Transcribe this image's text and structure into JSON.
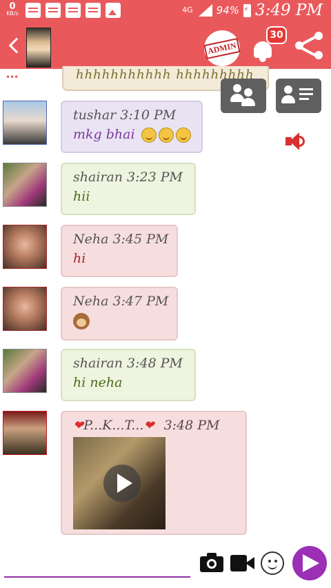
{
  "statusbar": {
    "data_speed": "0",
    "data_unit": "KB/s",
    "network": "4G",
    "battery": "94%",
    "time": "3:49 PM"
  },
  "appbar": {
    "admin_label": "ADMIN",
    "notification_count": "30"
  },
  "chat": {
    "top_bubble_text": "hhhhhhhhhhh hhhhhhhhh",
    "messages": [
      {
        "name": "tushar",
        "time": "3:10 PM",
        "text": "mkg bhai",
        "style": "purple",
        "emojis": 3
      },
      {
        "name": "shairan",
        "time": "3:23 PM",
        "text": "hii",
        "style": "green"
      },
      {
        "name": "Neha",
        "time": "3:45 PM",
        "text": "hi",
        "style": "pink"
      },
      {
        "name": "Neha",
        "time": "3:47 PM",
        "text": "",
        "style": "pink",
        "sticker": "monkey"
      },
      {
        "name": "shairan",
        "time": "3:48 PM",
        "text": "hi neha",
        "style": "green"
      },
      {
        "name": "P...K...T...",
        "time": "3:48 PM",
        "text": "",
        "style": "pink",
        "attachment": "video"
      }
    ]
  },
  "icons": {
    "back": "chevron-left-icon",
    "notifications": "bell-icon",
    "share": "share-icon",
    "group": "group-icon",
    "contact": "contact-card-icon",
    "speaker": "speaker-icon",
    "camera": "camera-icon",
    "video": "video-camera-icon",
    "emoji": "smiley-icon",
    "send": "send-icon"
  },
  "colors": {
    "accent": "#e9595c",
    "send": "#9b2fb5"
  }
}
